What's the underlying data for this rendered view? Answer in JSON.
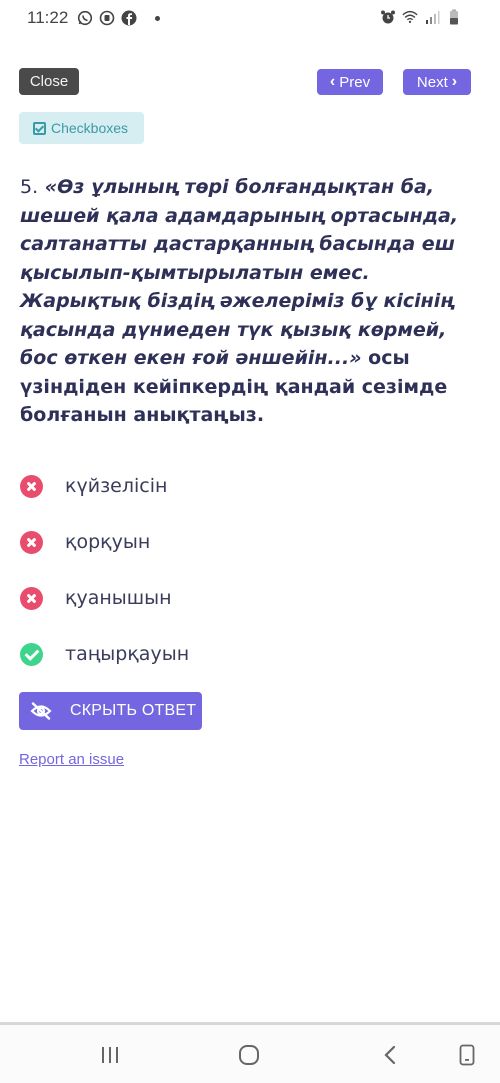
{
  "status_bar": {
    "time": "11:22",
    "left_icons": [
      "whatsapp-icon",
      "message-icon",
      "facebook-icon",
      "notification-dot"
    ],
    "right_icons": [
      "alarm-icon",
      "wifi-icon",
      "signal-icon",
      "battery-icon"
    ]
  },
  "toolbar": {
    "close_label": "Close",
    "prev_label": "Prev",
    "next_label": "Next"
  },
  "badge": {
    "label": "Checkboxes",
    "icon": "checkbox-icon"
  },
  "question": {
    "number": "5.",
    "quote": "«Өз ұлының төрі болғандықтан ба, шешей қала адамдарының ортасында, салтанатты дастарқанның басында еш қысылып-қымтырылатын емес. Жарықтық біздің әжелеріміз бұ кісінің қасында дүниеден түк қызық көрмей, бос өткен екен ғой әншейін...»",
    "prompt": "осы үзіндіден кейіпкердің қандай сезімде болғанын анықтаңыз."
  },
  "answers": [
    {
      "label": "күйзелісін",
      "status": "wrong",
      "icon": "cross-circle-icon"
    },
    {
      "label": "қорқуын",
      "status": "wrong",
      "icon": "cross-circle-icon"
    },
    {
      "label": "қуанышын",
      "status": "wrong",
      "icon": "cross-circle-icon"
    },
    {
      "label": "таңырқауын",
      "status": "correct",
      "icon": "check-circle-icon"
    }
  ],
  "hide_answer": {
    "label": "СКРЫТЬ ОТВЕТ",
    "icon": "eye-slash-icon"
  },
  "report_link": "Report an issue",
  "colors": {
    "accent": "#7466e0",
    "wrong": "#e94d6e",
    "correct": "#3ed48c",
    "text": "#2e3057",
    "badge_bg": "#d6edf1",
    "badge_text": "#3c9aa5"
  },
  "android_nav": [
    "recents-icon",
    "home-icon",
    "back-icon",
    "screen-icon"
  ]
}
